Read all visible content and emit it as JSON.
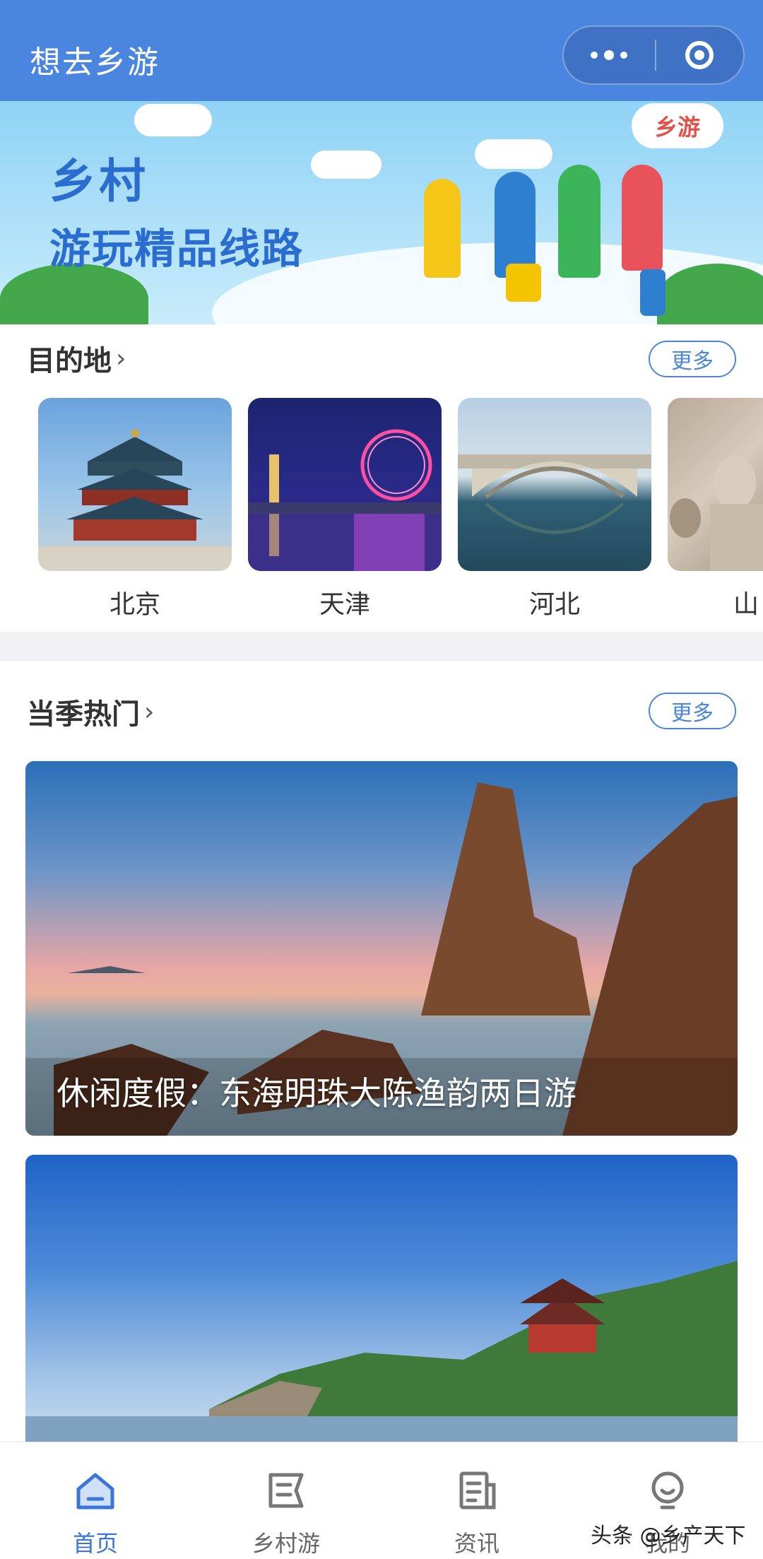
{
  "nav": {
    "title": "想去乡游"
  },
  "banner": {
    "title_line1": "乡村",
    "title_line2": "游玩精品线路",
    "logo_text": "乡游"
  },
  "destinations": {
    "title": "目的地",
    "more_label": "更多",
    "items": [
      {
        "label": "北京"
      },
      {
        "label": "天津"
      },
      {
        "label": "河北"
      },
      {
        "label": "山"
      }
    ]
  },
  "hot": {
    "title": "当季热门",
    "more_label": "更多",
    "cards": [
      {
        "caption": "休闲度假：东海明珠大陈渔韵两日游"
      }
    ]
  },
  "tabbar": {
    "items": [
      {
        "label": "首页",
        "icon": "home-icon",
        "active": true
      },
      {
        "label": "乡村游",
        "icon": "map-icon",
        "active": false
      },
      {
        "label": "资讯",
        "icon": "news-icon",
        "active": false
      },
      {
        "label": "我的",
        "icon": "user-icon",
        "active": false
      }
    ]
  },
  "watermark": "头条 @乡产天下",
  "colors": {
    "primary": "#4a86e0",
    "active_tab": "#3a76d8"
  }
}
